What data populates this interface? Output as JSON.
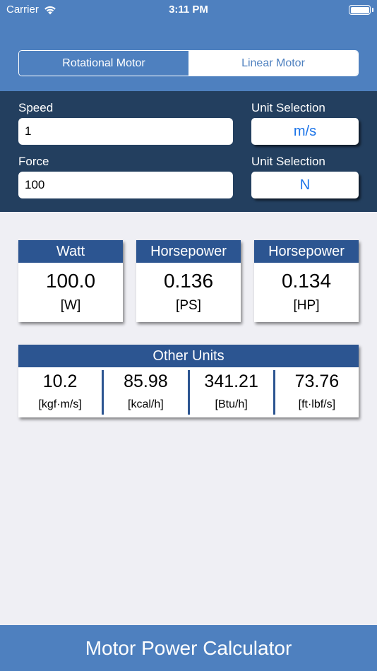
{
  "status_bar": {
    "carrier": "Carrier",
    "wifi_icon": "wifi-icon",
    "time": "3:11 PM",
    "battery_icon": "battery-icon"
  },
  "mode_selector": {
    "rotational": "Rotational Motor",
    "linear": "Linear Motor",
    "selected": "Rotational Motor"
  },
  "inputs": {
    "speed_label": "Speed",
    "speed_value": "1",
    "speed_unit_label": "Unit Selection",
    "speed_unit": "m/s",
    "force_label": "Force",
    "force_value": "100",
    "force_unit_label": "Unit Selection",
    "force_unit": "N"
  },
  "results": [
    {
      "title": "Watt",
      "value": "100.0",
      "unit": "[W]"
    },
    {
      "title": "Horsepower",
      "value": "0.136",
      "unit": "[PS]"
    },
    {
      "title": "Horsepower",
      "value": "0.134",
      "unit": "[HP]"
    }
  ],
  "other_units": {
    "title": "Other Units",
    "cells": [
      {
        "value": "10.2",
        "unit": "[kgf·m/s]"
      },
      {
        "value": "85.98",
        "unit": "[kcal/h]"
      },
      {
        "value": "341.21",
        "unit": "[Btu/h]"
      },
      {
        "value": "73.76",
        "unit": "[ft·lbf/s]"
      }
    ]
  },
  "footer": {
    "title": "Motor Power Calculator"
  },
  "colors": {
    "header_blue": "#4e80bf",
    "panel_navy": "#233f5f",
    "card_header": "#2c5591",
    "unit_text": "#1a73e8",
    "background": "#efeff4"
  }
}
